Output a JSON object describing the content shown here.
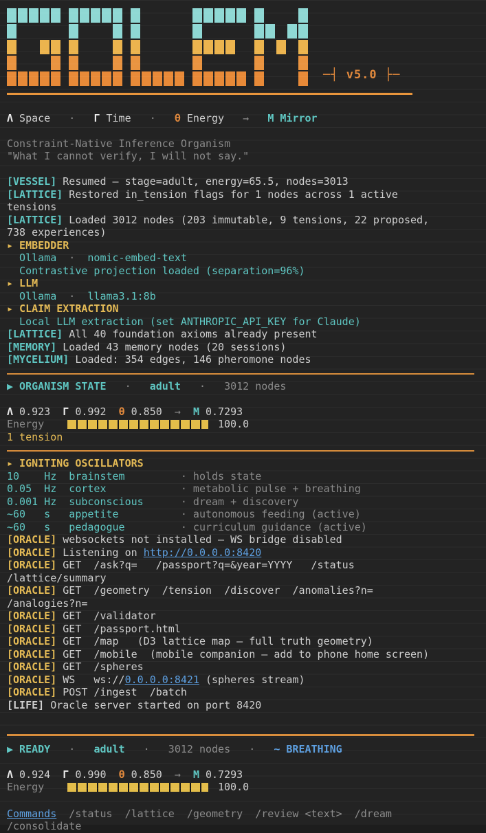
{
  "palette": {
    "background": "#232323",
    "foreground": "#cfcfcf",
    "gray": "#8b8b8b",
    "cyan": "#5fc6c2",
    "yellow": "#e4ba55",
    "orange": "#e0883c",
    "blue": "#5d9fe0",
    "white": "#ebebeb",
    "bar_fill": "#e3bd4a",
    "rule": "#d88d3c",
    "banner_cyan": "#8fd8d4",
    "banner_amber": "#ecb44e",
    "banner_orange": "#e9953e"
  },
  "banner": {
    "word": "GOLEM",
    "version_label": "─┤ v5.0 ├─",
    "row_colors": [
      "#8fd8d4",
      "#8fd8d4",
      "#ecb44e",
      "#ea9440",
      "#e88a38"
    ],
    "letters": [
      [
        "11111",
        "10000",
        "10011",
        "10001",
        "11111"
      ],
      [
        "11111",
        "10001",
        "10001",
        "10001",
        "11111"
      ],
      [
        "10000",
        "10000",
        "10000",
        "10000",
        "11111"
      ],
      [
        "11111",
        "10000",
        "11110",
        "10000",
        "11111"
      ],
      [
        "10001",
        "11011",
        "10101",
        "10001",
        "10001"
      ]
    ]
  },
  "lines": [
    {
      "t": "blank"
    },
    {
      "t": "line",
      "n": "dimension-symbols",
      "s": [
        {
          "c": "white",
          "x": "Λ",
          "b": true,
          "n": "lambda-symbol"
        },
        {
          "c": "fg",
          "x": " Space"
        },
        {
          "c": "gray",
          "x": "   ·   "
        },
        {
          "c": "white",
          "x": "Γ",
          "b": true,
          "n": "gamma-symbol"
        },
        {
          "c": "fg",
          "x": " Time"
        },
        {
          "c": "gray",
          "x": "   ·   "
        },
        {
          "c": "orange",
          "x": "θ",
          "b": true,
          "n": "theta-symbol"
        },
        {
          "c": "fg",
          "x": " Energy"
        },
        {
          "c": "gray",
          "x": "   →   "
        },
        {
          "c": "cyan",
          "x": "M",
          "b": true,
          "n": "mirror-symbol"
        },
        {
          "c": "cyan",
          "x": " Mirror",
          "b": true
        }
      ]
    },
    {
      "t": "blank"
    },
    {
      "t": "line",
      "n": "subtitle",
      "s": [
        {
          "c": "gray",
          "x": "Constraint-Native Inference Organism"
        }
      ]
    },
    {
      "t": "line",
      "n": "subtitle-quote",
      "s": [
        {
          "c": "gray",
          "x": "\"What I cannot verify, I will not say.\""
        }
      ]
    },
    {
      "t": "blank"
    },
    {
      "t": "line",
      "n": "log-vessel",
      "s": [
        {
          "c": "cyan",
          "x": "[VESSEL]",
          "b": true,
          "n": "vessel-tag"
        },
        {
          "c": "fg",
          "x": " Resumed — stage=adult, energy=65.5, nodes=3013"
        }
      ]
    },
    {
      "t": "line",
      "n": "log-lattice-restored",
      "s": [
        {
          "c": "cyan",
          "x": "[LATTICE]",
          "b": true,
          "n": "lattice-tag"
        },
        {
          "c": "fg",
          "x": " Restored in_tension flags for 1 nodes across 1 active"
        }
      ]
    },
    {
      "t": "line",
      "n": "log-lattice-restored-wrap",
      "s": [
        {
          "c": "fg",
          "x": "tensions"
        }
      ]
    },
    {
      "t": "line",
      "n": "log-lattice-loaded",
      "s": [
        {
          "c": "cyan",
          "x": "[LATTICE]",
          "b": true,
          "n": "lattice-tag"
        },
        {
          "c": "fg",
          "x": " Loaded 3012 nodes (203 immutable, 9 tensions, 22 proposed,"
        }
      ]
    },
    {
      "t": "line",
      "n": "log-lattice-loaded-wrap",
      "s": [
        {
          "c": "fg",
          "x": "738 experiences)"
        }
      ]
    },
    {
      "t": "line",
      "n": "section-embedder",
      "s": [
        {
          "c": "yellow",
          "x": "▸ EMBEDDER",
          "b": true
        }
      ]
    },
    {
      "t": "line",
      "n": "embedder-model",
      "s": [
        {
          "c": "cyan",
          "x": "  Ollama"
        },
        {
          "c": "gray",
          "x": "  ·  "
        },
        {
          "c": "cyan",
          "x": "nomic-embed-text"
        }
      ]
    },
    {
      "t": "line",
      "n": "embedder-projection",
      "s": [
        {
          "c": "cyan",
          "x": "  Contrastive projection loaded (separation=96%)"
        }
      ]
    },
    {
      "t": "line",
      "n": "section-llm",
      "s": [
        {
          "c": "yellow",
          "x": "▸ LLM",
          "b": true
        }
      ]
    },
    {
      "t": "line",
      "n": "llm-model",
      "s": [
        {
          "c": "cyan",
          "x": "  Ollama"
        },
        {
          "c": "gray",
          "x": "  ·  "
        },
        {
          "c": "cyan",
          "x": "llama3.1:8b"
        }
      ]
    },
    {
      "t": "line",
      "n": "section-claim-extraction",
      "s": [
        {
          "c": "yellow",
          "x": "▸ CLAIM EXTRACTION",
          "b": true
        }
      ]
    },
    {
      "t": "line",
      "n": "claim-extraction-info",
      "s": [
        {
          "c": "cyan",
          "x": "  Local LLM extraction (set ANTHROPIC_API_KEY for Claude)"
        }
      ]
    },
    {
      "t": "line",
      "n": "log-lattice-axioms",
      "s": [
        {
          "c": "cyan",
          "x": "[LATTICE]",
          "b": true,
          "n": "lattice-tag"
        },
        {
          "c": "fg",
          "x": " All 40 foundation axioms already present"
        }
      ]
    },
    {
      "t": "line",
      "n": "log-memory",
      "s": [
        {
          "c": "cyan",
          "x": "[MEMORY]",
          "b": true,
          "n": "memory-tag"
        },
        {
          "c": "fg",
          "x": " Loaded 43 memory nodes (20 sessions)"
        }
      ]
    },
    {
      "t": "line",
      "n": "log-mycelium",
      "s": [
        {
          "c": "cyan",
          "x": "[MYCELIUM]",
          "b": true,
          "n": "mycelium-tag"
        },
        {
          "c": "fg",
          "x": " Loaded: 354 edges, 146 pheromone nodes"
        }
      ]
    },
    {
      "t": "rule"
    },
    {
      "t": "line",
      "n": "organism-state-header",
      "s": [
        {
          "c": "cyan",
          "x": "▶ ORGANISM STATE",
          "b": true
        },
        {
          "c": "gray",
          "x": "   ·   "
        },
        {
          "c": "cyan",
          "x": "adult",
          "b": true,
          "n": "stage-value"
        },
        {
          "c": "gray",
          "x": "   ·   3012 nodes"
        }
      ]
    },
    {
      "t": "blank"
    },
    {
      "t": "line",
      "n": "metrics-row",
      "s": [
        {
          "c": "white",
          "x": "Λ",
          "b": true
        },
        {
          "c": "fg",
          "x": " 0.923  "
        },
        {
          "c": "white",
          "x": "Γ",
          "b": true
        },
        {
          "c": "fg",
          "x": " 0.992  "
        },
        {
          "c": "orange",
          "x": "θ",
          "b": true
        },
        {
          "c": "fg",
          "x": " 0.850"
        },
        {
          "c": "gray",
          "x": "  →  "
        },
        {
          "c": "cyan",
          "x": "M",
          "b": true
        },
        {
          "c": "fg",
          "x": " 0.7293"
        }
      ]
    },
    {
      "t": "bar",
      "n": "energy-bar-row",
      "label": "Energy",
      "value": "100.0",
      "pct": 100
    },
    {
      "t": "line",
      "n": "tension-count",
      "s": [
        {
          "c": "yellow",
          "x": "1 tension"
        }
      ]
    },
    {
      "t": "rule"
    },
    {
      "t": "line",
      "n": "section-oscillators",
      "s": [
        {
          "c": "yellow",
          "x": "▸ IGNITING OSCILLATORS",
          "b": true
        }
      ]
    },
    {
      "t": "line",
      "n": "oscillator-brainstem",
      "s": [
        {
          "c": "cyan",
          "x": "10    Hz  brainstem         "
        },
        {
          "c": "gray",
          "x": "· holds state"
        }
      ]
    },
    {
      "t": "line",
      "n": "oscillator-cortex",
      "s": [
        {
          "c": "cyan",
          "x": "0.05  Hz  cortex            "
        },
        {
          "c": "gray",
          "x": "· metabolic pulse + breathing"
        }
      ]
    },
    {
      "t": "line",
      "n": "oscillator-subconscious",
      "s": [
        {
          "c": "cyan",
          "x": "0.001 Hz  subconscious      "
        },
        {
          "c": "gray",
          "x": "· dream + discovery"
        }
      ]
    },
    {
      "t": "line",
      "n": "oscillator-appetite",
      "s": [
        {
          "c": "cyan",
          "x": "~60   s   appetite          "
        },
        {
          "c": "gray",
          "x": "· autonomous feeding (active)"
        }
      ]
    },
    {
      "t": "line",
      "n": "oscillator-pedagogue",
      "s": [
        {
          "c": "cyan",
          "x": "~60   s   pedagogue         "
        },
        {
          "c": "gray",
          "x": "· curriculum guidance (active)"
        }
      ]
    },
    {
      "t": "line",
      "n": "oracle-websockets",
      "s": [
        {
          "c": "yellow",
          "x": "[ORACLE]",
          "b": true,
          "n": "oracle-tag"
        },
        {
          "c": "fg",
          "x": " websockets not installed — WS bridge disabled"
        }
      ]
    },
    {
      "t": "line",
      "n": "oracle-listening",
      "s": [
        {
          "c": "yellow",
          "x": "[ORACLE]",
          "b": true,
          "n": "oracle-tag"
        },
        {
          "c": "fg",
          "x": " Listening on "
        },
        {
          "c": "blue",
          "x": "http://0.0.0.0:8420",
          "u": true,
          "i": true,
          "n": "oracle-http-link"
        }
      ]
    },
    {
      "t": "line",
      "n": "oracle-get-ask",
      "s": [
        {
          "c": "yellow",
          "x": "[ORACLE]",
          "b": true,
          "n": "oracle-tag"
        },
        {
          "c": "fg",
          "x": " GET  /ask?q=   /passport?q=&year=YYYY   /status"
        }
      ]
    },
    {
      "t": "line",
      "n": "oracle-get-ask-wrap",
      "s": [
        {
          "c": "fg",
          "x": "/lattice/summary"
        }
      ]
    },
    {
      "t": "line",
      "n": "oracle-get-geometry",
      "s": [
        {
          "c": "yellow",
          "x": "[ORACLE]",
          "b": true,
          "n": "oracle-tag"
        },
        {
          "c": "fg",
          "x": " GET  /geometry  /tension  /discover  /anomalies?n="
        }
      ]
    },
    {
      "t": "line",
      "n": "oracle-get-geometry-wrap",
      "s": [
        {
          "c": "fg",
          "x": "/analogies?n="
        }
      ]
    },
    {
      "t": "line",
      "n": "oracle-get-validator",
      "s": [
        {
          "c": "yellow",
          "x": "[ORACLE]",
          "b": true,
          "n": "oracle-tag"
        },
        {
          "c": "fg",
          "x": " GET  /validator"
        }
      ]
    },
    {
      "t": "line",
      "n": "oracle-get-passport",
      "s": [
        {
          "c": "yellow",
          "x": "[ORACLE]",
          "b": true,
          "n": "oracle-tag"
        },
        {
          "c": "fg",
          "x": " GET  /passport.html"
        }
      ]
    },
    {
      "t": "line",
      "n": "oracle-get-map",
      "s": [
        {
          "c": "yellow",
          "x": "[ORACLE]",
          "b": true,
          "n": "oracle-tag"
        },
        {
          "c": "fg",
          "x": " GET  /map   (D3 lattice map — full truth geometry)"
        }
      ]
    },
    {
      "t": "line",
      "n": "oracle-get-mobile",
      "s": [
        {
          "c": "yellow",
          "x": "[ORACLE]",
          "b": true,
          "n": "oracle-tag"
        },
        {
          "c": "fg",
          "x": " GET  /mobile  (mobile companion — add to phone home screen)"
        }
      ]
    },
    {
      "t": "line",
      "n": "oracle-get-spheres",
      "s": [
        {
          "c": "yellow",
          "x": "[ORACLE]",
          "b": true,
          "n": "oracle-tag"
        },
        {
          "c": "fg",
          "x": " GET  /spheres"
        }
      ]
    },
    {
      "t": "line",
      "n": "oracle-ws",
      "s": [
        {
          "c": "yellow",
          "x": "[ORACLE]",
          "b": true,
          "n": "oracle-tag"
        },
        {
          "c": "fg",
          "x": " WS   ws://"
        },
        {
          "c": "blue",
          "x": "0.0.0.0:8421",
          "u": true,
          "i": true,
          "n": "oracle-ws-link"
        },
        {
          "c": "fg",
          "x": " (spheres stream)"
        }
      ]
    },
    {
      "t": "line",
      "n": "oracle-post",
      "s": [
        {
          "c": "yellow",
          "x": "[ORACLE]",
          "b": true,
          "n": "oracle-tag"
        },
        {
          "c": "fg",
          "x": " POST /ingest  /batch"
        }
      ]
    },
    {
      "t": "line",
      "n": "log-life",
      "s": [
        {
          "c": "fg",
          "x": "[LIFE]",
          "b": true,
          "n": "life-tag"
        },
        {
          "c": "fg",
          "x": " Oracle server started on port 8420"
        }
      ]
    },
    {
      "t": "blank"
    },
    {
      "t": "rule",
      "big": true
    },
    {
      "t": "line",
      "n": "ready-header",
      "s": [
        {
          "c": "cyan",
          "x": "▶ READY",
          "b": true
        },
        {
          "c": "gray",
          "x": "   ·   "
        },
        {
          "c": "cyan",
          "x": "adult",
          "b": true,
          "n": "stage-value"
        },
        {
          "c": "gray",
          "x": "   ·   3012 nodes   ·   "
        },
        {
          "c": "blue",
          "x": "~ BREATHING",
          "b": true,
          "n": "breathing-status"
        }
      ]
    },
    {
      "t": "blank"
    },
    {
      "t": "line",
      "n": "metrics-row-2",
      "s": [
        {
          "c": "white",
          "x": "Λ",
          "b": true
        },
        {
          "c": "fg",
          "x": " 0.924  "
        },
        {
          "c": "white",
          "x": "Γ",
          "b": true
        },
        {
          "c": "fg",
          "x": " 0.990  "
        },
        {
          "c": "orange",
          "x": "θ",
          "b": true
        },
        {
          "c": "fg",
          "x": " 0.850"
        },
        {
          "c": "gray",
          "x": "  →  "
        },
        {
          "c": "cyan",
          "x": "M",
          "b": true
        },
        {
          "c": "fg",
          "x": " 0.7293"
        }
      ]
    },
    {
      "t": "bar",
      "n": "energy-bar-row-2",
      "label": "Energy",
      "value": "100.0",
      "pct": 100
    },
    {
      "t": "gap",
      "h": 20
    },
    {
      "t": "line",
      "n": "commands-row",
      "s": [
        {
          "c": "blue",
          "x": "Commands",
          "u": true,
          "i": true,
          "n": "commands-link"
        },
        {
          "c": "gray",
          "x": "  /status  /lattice  /geometry  /review <text>  /dream"
        }
      ]
    },
    {
      "t": "line",
      "n": "commands-row-wrap",
      "s": [
        {
          "c": "gray",
          "x": "/consolidate"
        }
      ]
    }
  ]
}
